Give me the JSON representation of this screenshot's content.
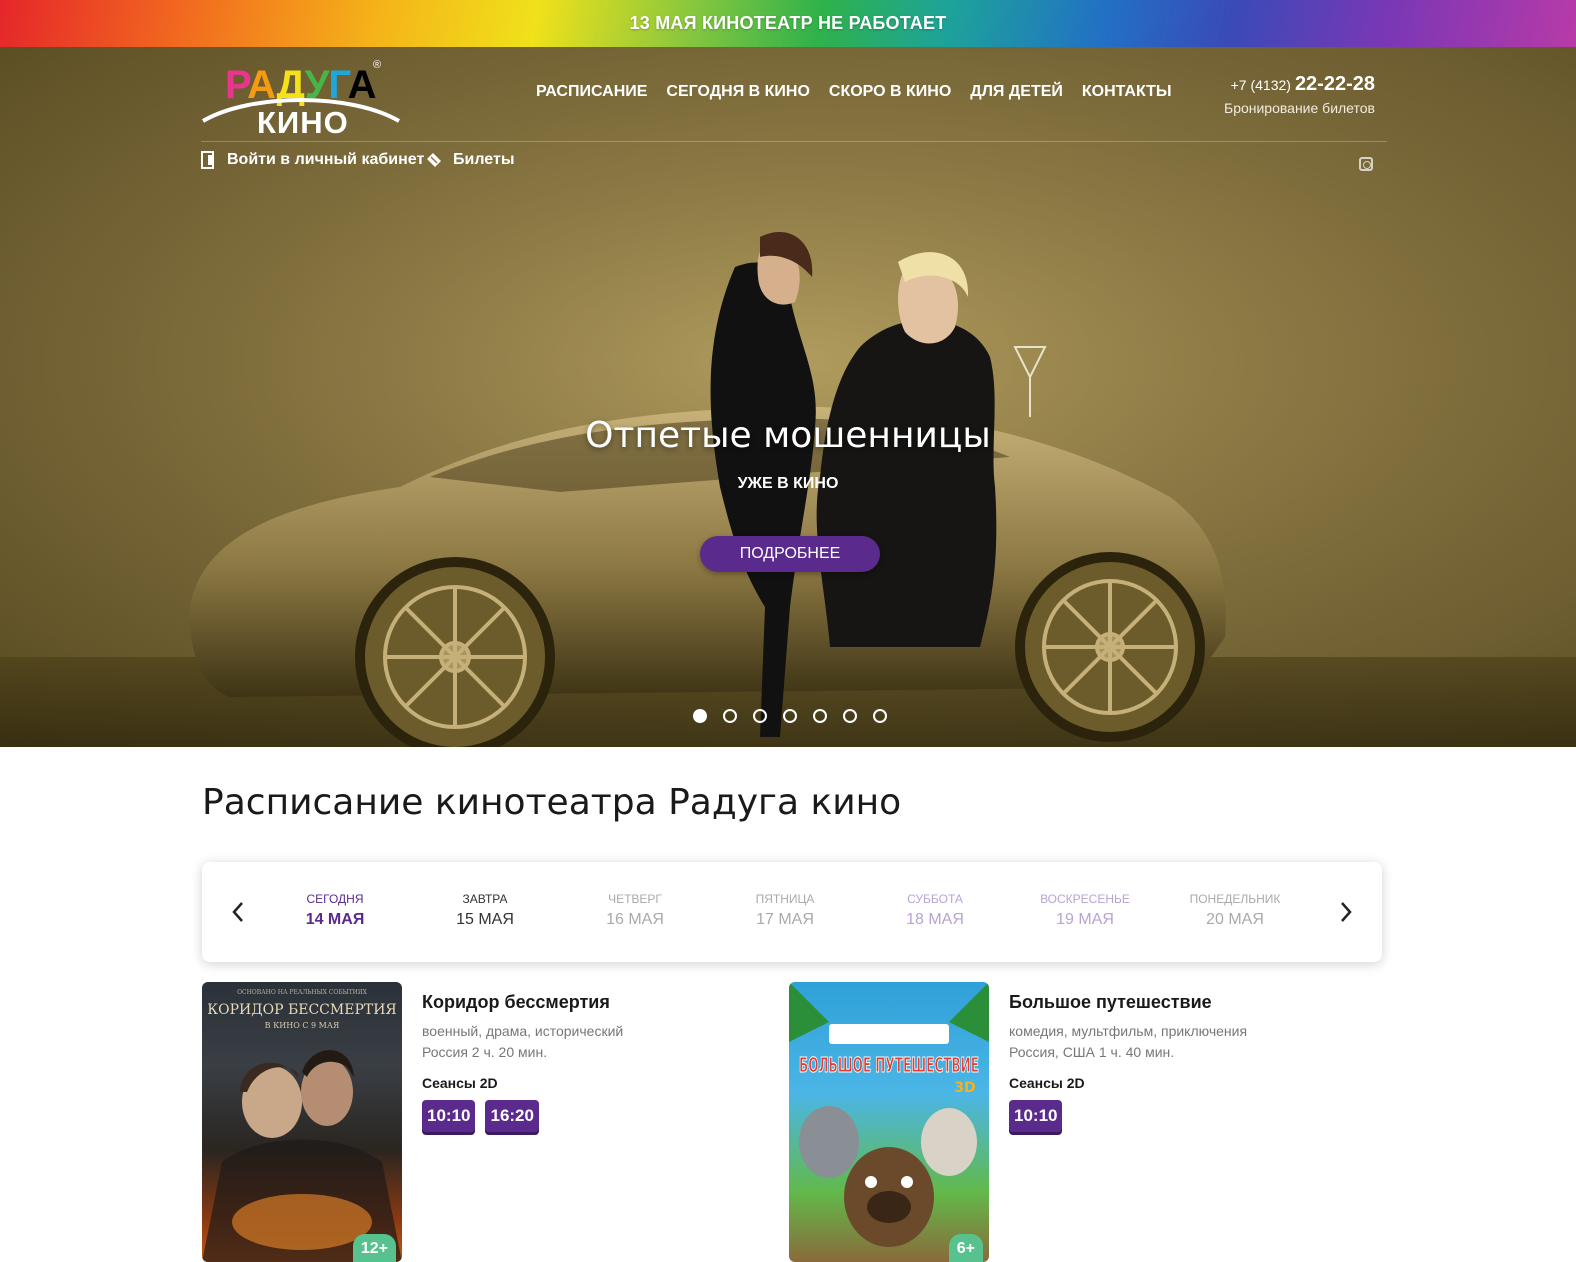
{
  "banner": {
    "text": "13 МАЯ КИНОТЕАТР НЕ РАБОТАЕТ"
  },
  "logo": {
    "word": [
      "Р",
      "А",
      "Д",
      "У",
      "Г",
      "А"
    ],
    "kino": "КИНО",
    "reg": "®"
  },
  "nav": [
    "РАСПИСАНИЕ",
    "СЕГОДНЯ В КИНО",
    "СКОРО В КИНО",
    "ДЛЯ ДЕТЕЙ",
    "КОНТАКТЫ"
  ],
  "phone": {
    "prefix": "+7 (4132)",
    "number": "22-22-28",
    "caption": "Бронирование билетов"
  },
  "subnav": {
    "cabinet": "Войти в личный кабинет",
    "tickets": "Билеты"
  },
  "hero": {
    "title": "Отпетые мошенницы",
    "subtitle": "УЖЕ В КИНО",
    "button": "ПОДРОБНЕЕ",
    "slides": 7,
    "active_slide": 1
  },
  "schedule": {
    "title": "Расписание кинотеатра Радуга кино",
    "days": [
      {
        "name": "СЕГОДНЯ",
        "date": "14 МАЯ",
        "state": "active"
      },
      {
        "name": "ЗАВТРА",
        "date": "15 МАЯ",
        "state": "normal"
      },
      {
        "name": "ЧЕТВЕРГ",
        "date": "16 МАЯ",
        "state": "muted"
      },
      {
        "name": "ПЯТНИЦА",
        "date": "17 МАЯ",
        "state": "muted"
      },
      {
        "name": "СУББОТА",
        "date": "18 МАЯ",
        "state": "weekend"
      },
      {
        "name": "ВОСКРЕСЕНЬЕ",
        "date": "19 МАЯ",
        "state": "weekend"
      },
      {
        "name": "ПОНЕДЕЛЬНИК",
        "date": "20 МАЯ",
        "state": "muted"
      }
    ]
  },
  "movies": [
    {
      "title": "Коридор бессмертия",
      "genre": "военный, драма, исторический",
      "meta": "Россия 2 ч. 20 мин.",
      "sessions_label": "Сеансы 2D",
      "sessions": [
        "10:10",
        "16:20"
      ],
      "age": "12+",
      "poster_title": "КОРИДОР БЕССМЕРТИЯ",
      "poster_note": "В КИНО С 9 МАЯ",
      "poster_top": "ОСНОВАНО НА РЕАЛЬНЫХ СОБЫТИЯХ"
    },
    {
      "title": "Большое путешествие",
      "genre": "комедия, мультфильм, приключения",
      "meta": "Россия, США 1 ч. 40 мин.",
      "sessions_label": "Сеансы 2D",
      "sessions": [
        "10:10"
      ],
      "age": "6+",
      "poster_title": "БОЛЬШОЕ ПУТЕШЕСТВИЕ",
      "poster_note": "3D"
    }
  ],
  "colors": {
    "accent": "#5b2a8d",
    "age_badge": "#58c28e",
    "day_active": "#5b2a8d",
    "day_weekend": "#b9a2d6",
    "day_muted": "#a8a8a8"
  }
}
